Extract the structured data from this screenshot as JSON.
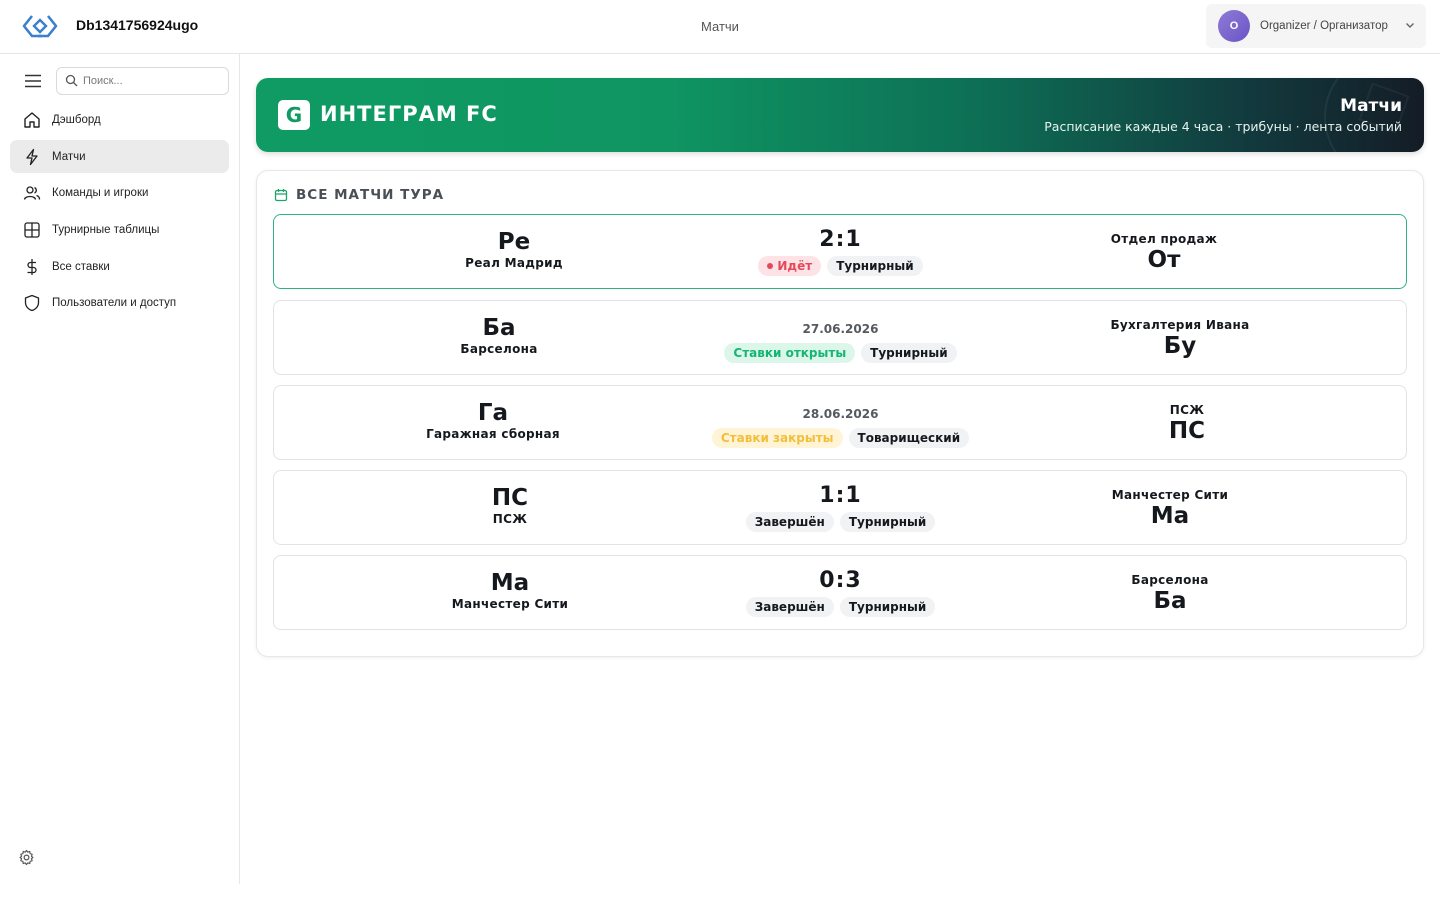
{
  "header": {
    "app_title": "Db1341756924ugo",
    "page_label": "Матчи",
    "user_initial": "O",
    "user_name": "Organizer / Организатор"
  },
  "sidebar": {
    "search_placeholder": "Поиск...",
    "items": [
      {
        "label": "Дэшборд",
        "icon": "home-icon"
      },
      {
        "label": "Матчи",
        "icon": "lightning-icon",
        "active": true
      },
      {
        "label": "Команды и игроки",
        "icon": "users-icon"
      },
      {
        "label": "Турнирные таблицы",
        "icon": "table-grid-icon"
      },
      {
        "label": "Все ставки",
        "icon": "dollar-icon"
      },
      {
        "label": "Пользователи и доступ",
        "icon": "shield-icon"
      }
    ]
  },
  "banner": {
    "badge_letter": "G",
    "brand": "ИНТЕГРАМ FC",
    "title": "Матчи",
    "subtitle": "Расписание каждые 4 часа · трибуны · лента событий"
  },
  "matches_section": {
    "title": "ВСЕ МАТЧИ ТУРА",
    "matches": [
      {
        "home_abbr": "Ре",
        "home_name": "Реал Мадрид",
        "score": "2:1",
        "date": "",
        "status": "Идёт",
        "status_kind": "live",
        "type": "Турнирный",
        "away_name": "Отдел продаж",
        "away_abbr": "От"
      },
      {
        "home_abbr": "Ба",
        "home_name": "Барселона",
        "score": "",
        "date": "27.06.2026",
        "status": "Ставки открыты",
        "status_kind": "open",
        "type": "Турнирный",
        "away_name": "Бухгалтерия Ивана",
        "away_abbr": "Бу"
      },
      {
        "home_abbr": "Га",
        "home_name": "Гаражная сборная",
        "score": "",
        "date": "28.06.2026",
        "status": "Ставки закрыты",
        "status_kind": "closed",
        "type": "Товарищеский",
        "away_name": "ПСЖ",
        "away_abbr": "ПС"
      },
      {
        "home_abbr": "ПС",
        "home_name": "ПСЖ",
        "score": "1:1",
        "date": "",
        "status": "Завершён",
        "status_kind": "done",
        "type": "Турнирный",
        "away_name": "Манчестер Сити",
        "away_abbr": "Ма"
      },
      {
        "home_abbr": "Ма",
        "home_name": "Манчестер Сити",
        "score": "0:3",
        "date": "",
        "status": "Завершён",
        "status_kind": "done",
        "type": "Турнирный",
        "away_name": "Барселона",
        "away_abbr": "Ба"
      }
    ]
  }
}
